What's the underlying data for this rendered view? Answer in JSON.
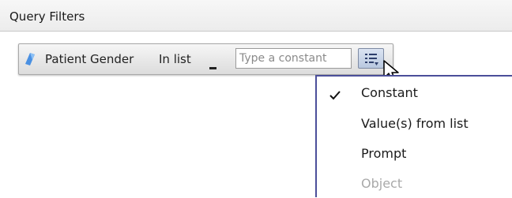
{
  "panel": {
    "title": "Query Filters"
  },
  "filter": {
    "object_name": "Patient Gender",
    "operator": "In list",
    "constant_placeholder": "Type a constant",
    "object_icon": "dimension-icon",
    "list_button_icon": "list-picker-icon"
  },
  "menu": {
    "items": [
      {
        "label": "Constant",
        "checked": true,
        "enabled": true
      },
      {
        "label": "Value(s) from list",
        "checked": false,
        "enabled": true
      },
      {
        "label": "Prompt",
        "checked": false,
        "enabled": true
      },
      {
        "label": "Object",
        "checked": false,
        "enabled": false
      }
    ]
  },
  "colors": {
    "menu_border": "#4b4f9a",
    "dimension_icon": "#4a90e2",
    "disabled_text": "#a9a9a9"
  }
}
